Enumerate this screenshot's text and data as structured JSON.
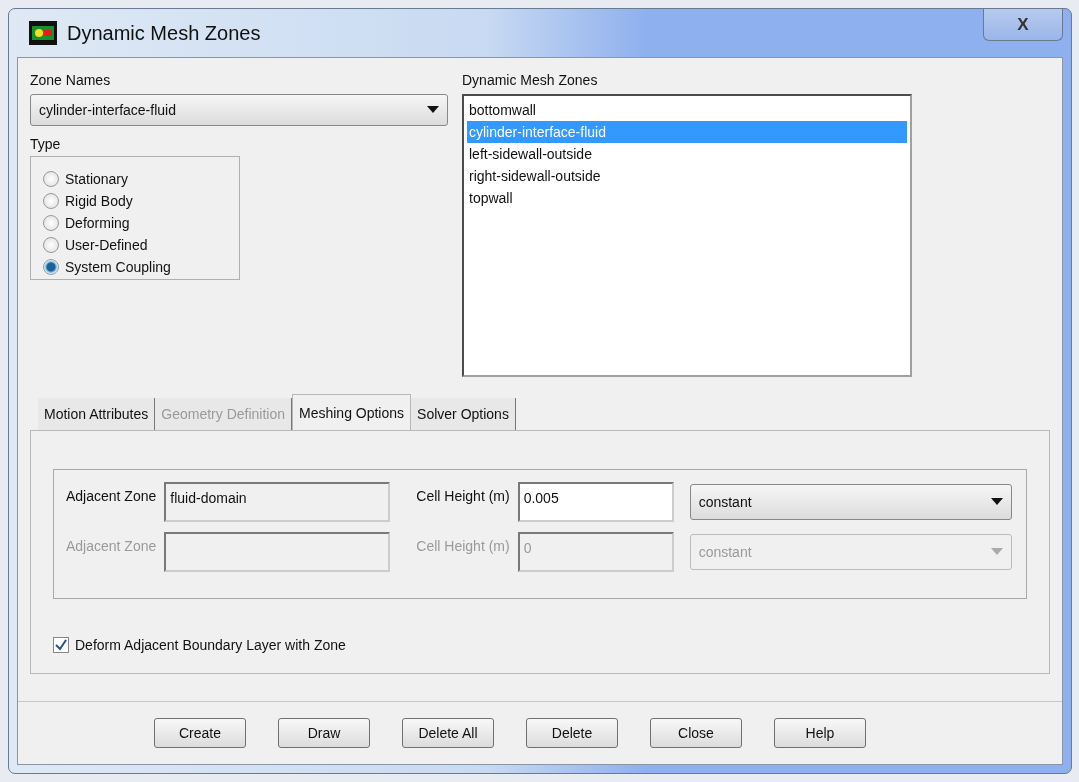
{
  "window": {
    "title": "Dynamic Mesh Zones",
    "close": "X"
  },
  "zone_names": {
    "label": "Zone Names",
    "value": "cylinder-interface-fluid"
  },
  "type": {
    "label": "Type",
    "options": [
      {
        "label": "Stationary",
        "selected": false
      },
      {
        "label": "Rigid Body",
        "selected": false
      },
      {
        "label": "Deforming",
        "selected": false
      },
      {
        "label": "User-Defined",
        "selected": false
      },
      {
        "label": "System Coupling",
        "selected": true
      }
    ]
  },
  "dynamic_mesh_zones": {
    "label": "Dynamic Mesh Zones",
    "items": [
      {
        "label": "bottomwall",
        "selected": false
      },
      {
        "label": "cylinder-interface-fluid",
        "selected": true
      },
      {
        "label": "left-sidewall-outside",
        "selected": false
      },
      {
        "label": "right-sidewall-outside",
        "selected": false
      },
      {
        "label": "topwall",
        "selected": false
      }
    ]
  },
  "tabs": [
    {
      "label": "Motion Attributes",
      "selected": false,
      "disabled": false
    },
    {
      "label": "Geometry Definition",
      "selected": false,
      "disabled": true
    },
    {
      "label": "Meshing Options",
      "selected": true,
      "disabled": false
    },
    {
      "label": "Solver Options",
      "selected": false,
      "disabled": false
    }
  ],
  "adjacent_rows": [
    {
      "zone_label": "Adjacent Zone",
      "zone_value": "fluid-domain",
      "height_label": "Cell Height (m)",
      "height_value": "0.005",
      "method": "constant",
      "disabled": false
    },
    {
      "zone_label": "Adjacent Zone",
      "height_label": "Cell Height (m)",
      "height_value": "0",
      "method": "constant",
      "disabled": true
    }
  ],
  "deform_checkbox": {
    "label": "Deform Adjacent Boundary Layer with Zone",
    "checked": true
  },
  "buttons": [
    "Create",
    "Draw",
    "Delete All",
    "Delete",
    "Close",
    "Help"
  ]
}
